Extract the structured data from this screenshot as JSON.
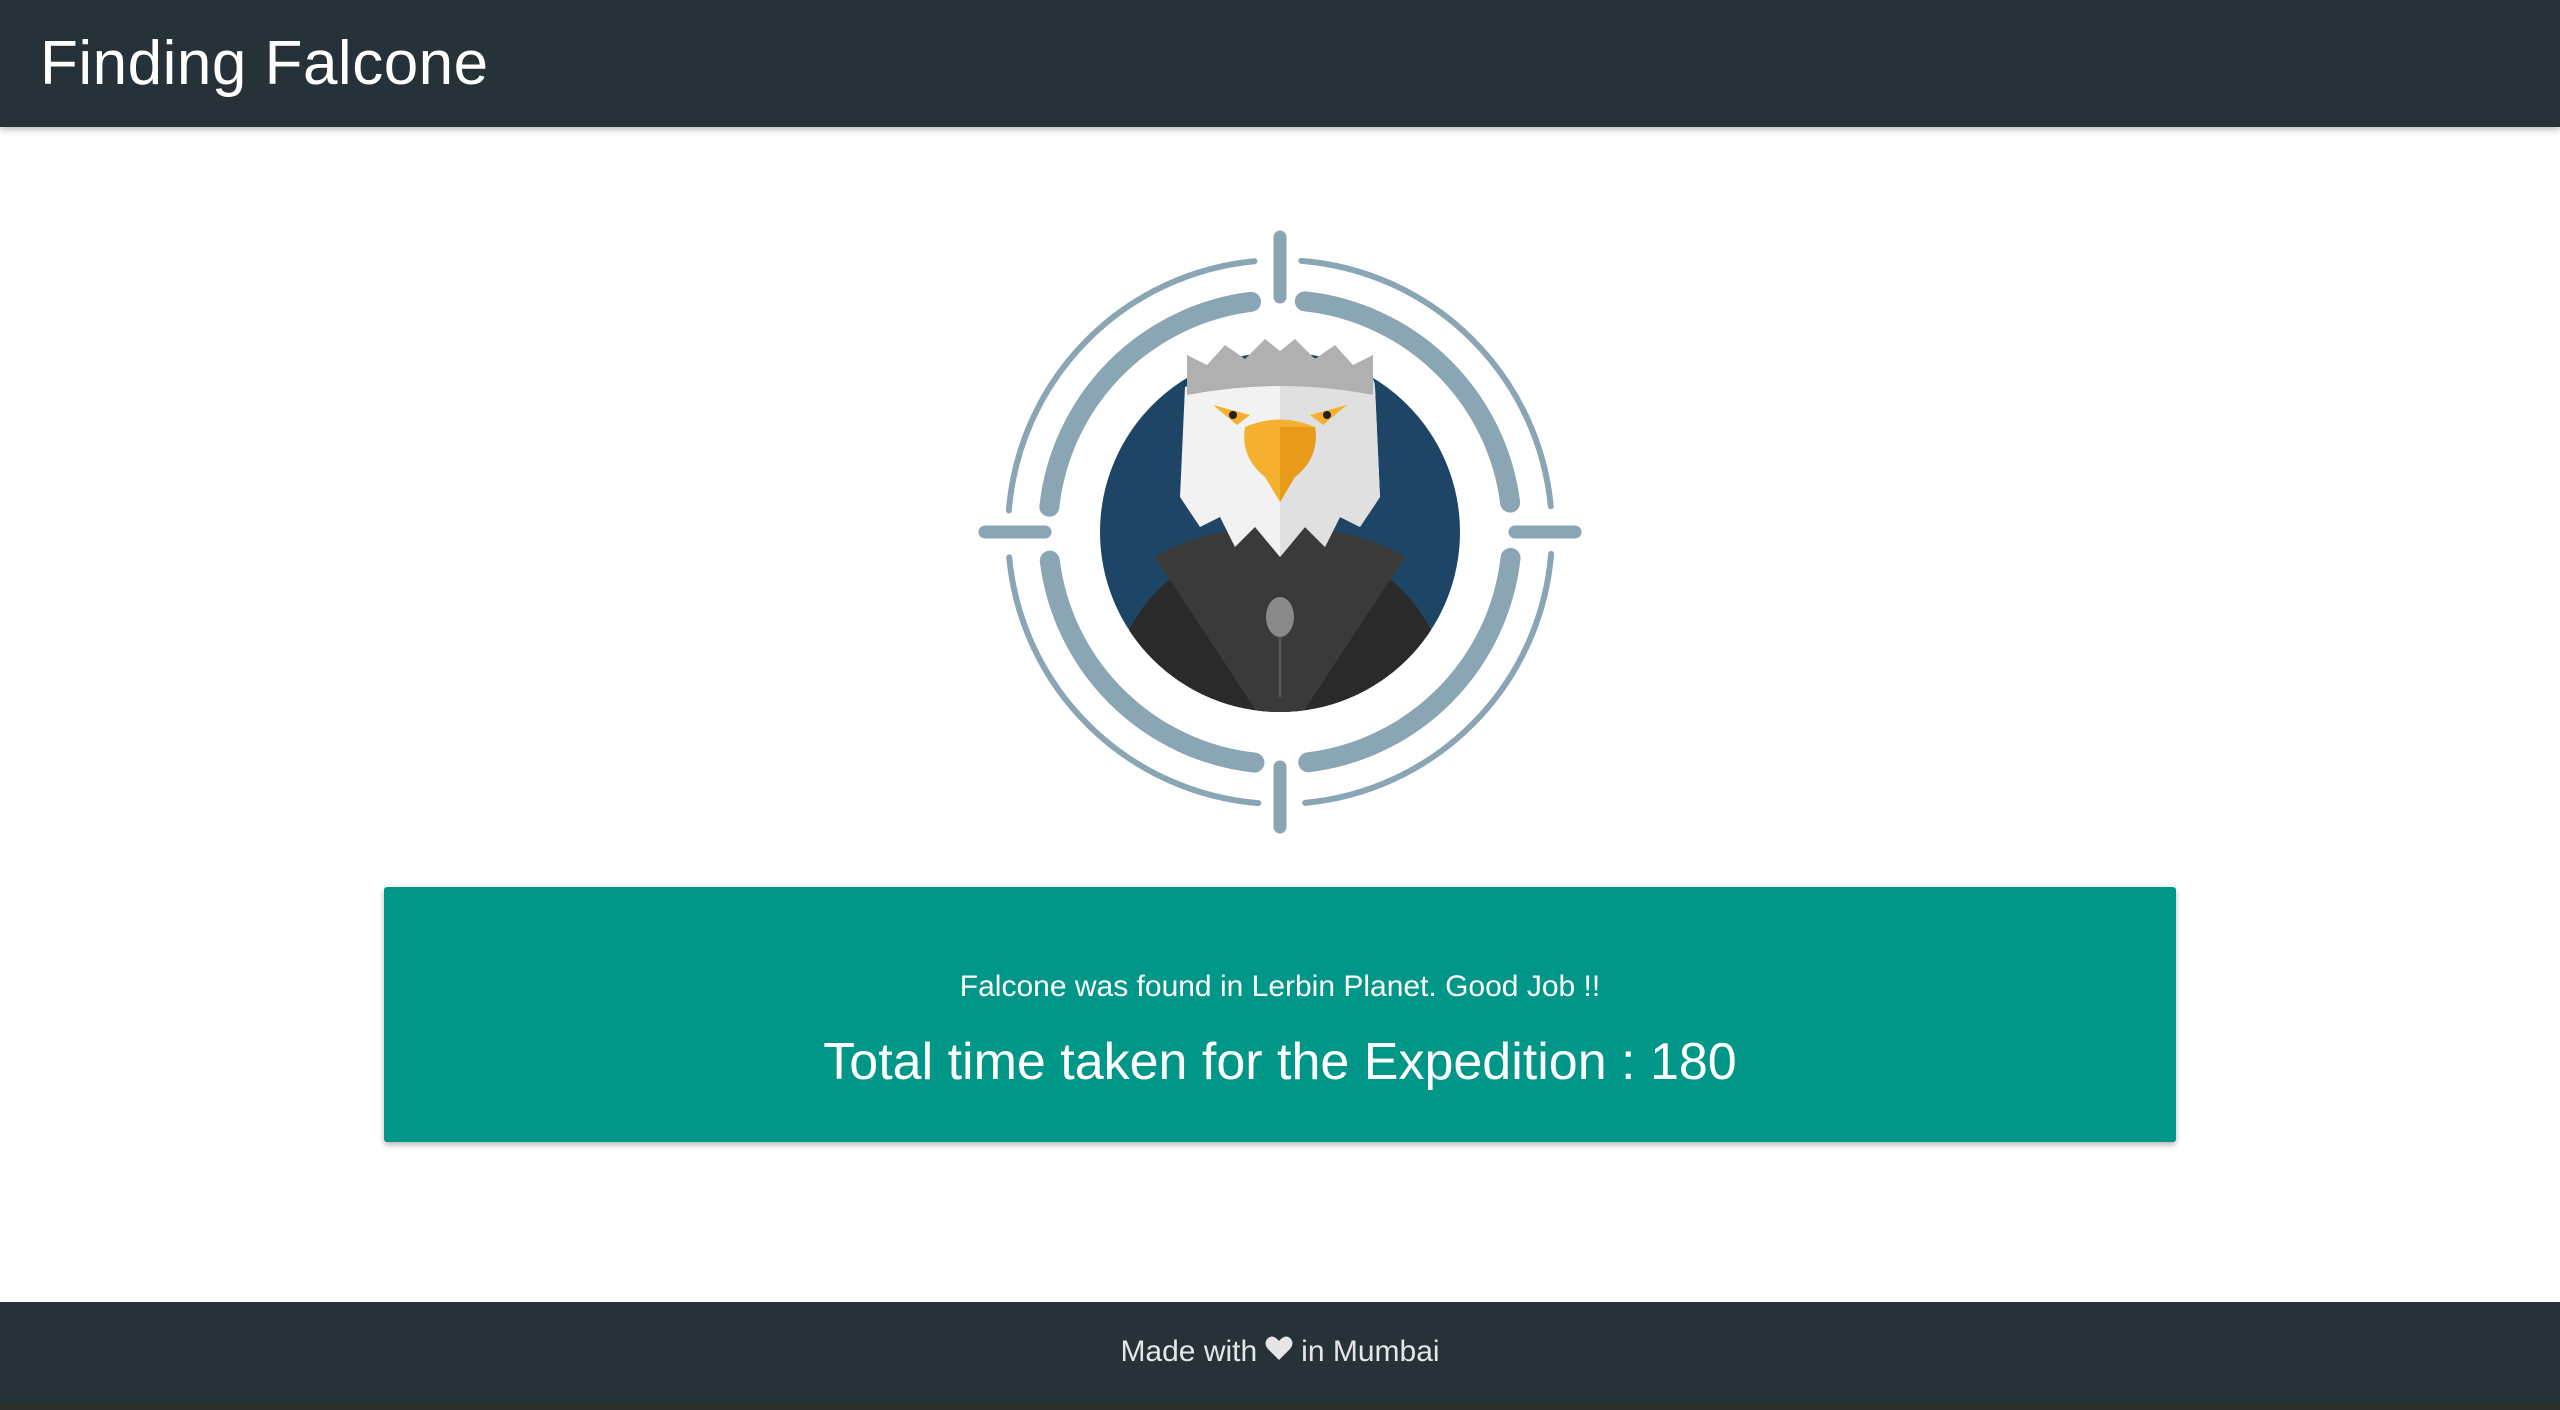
{
  "header": {
    "title": "Finding Falcone"
  },
  "emblem": {
    "icon": "falcon-target-icon",
    "colors": {
      "ring": "#8aa5b3",
      "circle_bg": "#1e4566",
      "body": "#2a2a2a",
      "beak": "#f5b030",
      "head": "#f2f2f2",
      "crown": "#b0b0b0"
    }
  },
  "result": {
    "message": "Falcone was found in Lerbin Planet. Good Job !!",
    "time_text": "Total time taken for the Expedition : 180",
    "color": "#009688"
  },
  "footer": {
    "prefix": "Made with",
    "heart_icon": "heart-icon",
    "suffix": "in Mumbai"
  },
  "theme": {
    "bar_color": "#263238"
  }
}
